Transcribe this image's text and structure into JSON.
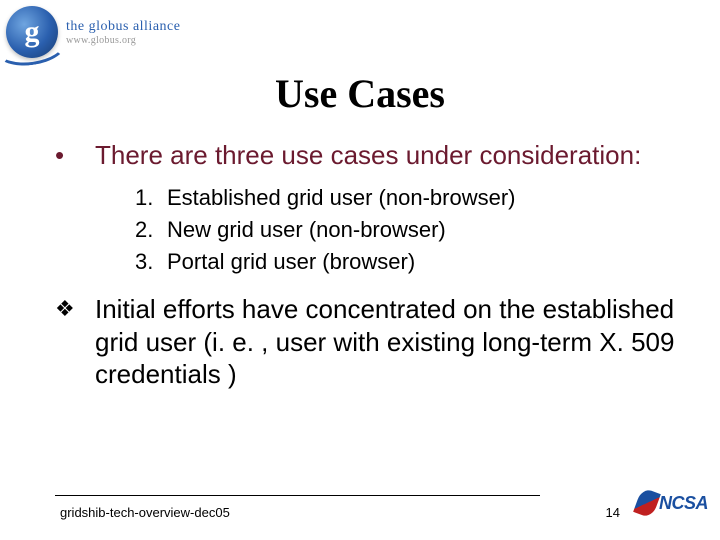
{
  "header": {
    "logo_text": "the globus alliance",
    "logo_sub": "www.globus.org",
    "logo_letter": "g"
  },
  "title": "Use Cases",
  "bullets": {
    "main_symbol": "•",
    "main_text": "There are three use cases under consideration:",
    "numbered": [
      {
        "n": "1.",
        "text": "Established grid user (non-browser)"
      },
      {
        "n": "2.",
        "text": "New grid user (non-browser)"
      },
      {
        "n": "3.",
        "text": "Portal grid user (browser)"
      }
    ],
    "diamond_symbol": "❖",
    "diamond_text": "Initial efforts have concentrated on the established grid user (i. e. , user with existing long-term X. 509 credentials )"
  },
  "footer": {
    "left": "gridshib-tech-overview-dec05",
    "page": "14",
    "ncsa": "NCSA"
  }
}
